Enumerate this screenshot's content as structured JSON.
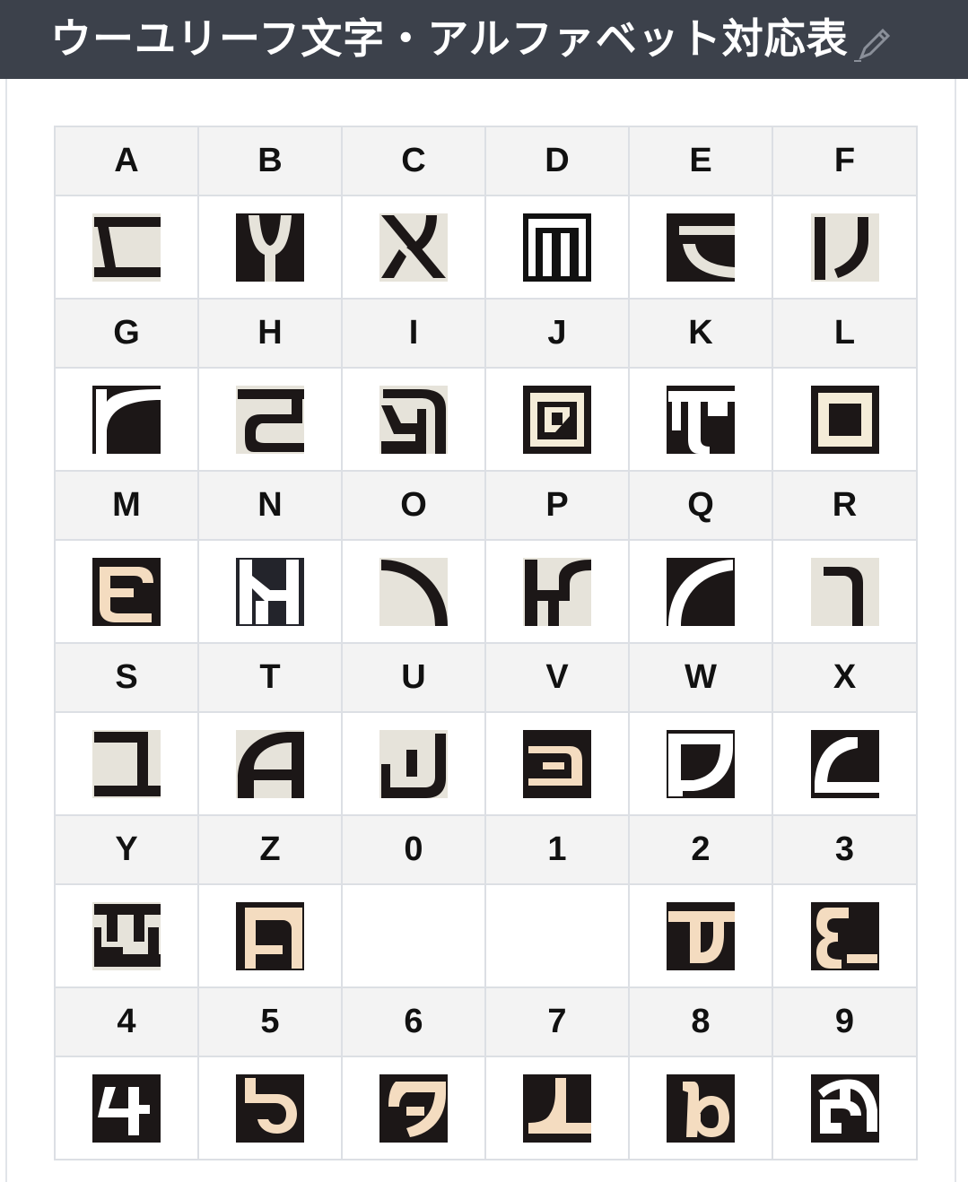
{
  "header": {
    "title": "ウーユリーフ文字・アルファベット対応表",
    "edit_icon": "pencil-icon"
  },
  "table": {
    "rows": [
      {
        "labels": [
          "A",
          "B",
          "C",
          "D",
          "E",
          "F"
        ]
      },
      {
        "labels": [
          "G",
          "H",
          "I",
          "J",
          "K",
          "L"
        ]
      },
      {
        "labels": [
          "M",
          "N",
          "O",
          "P",
          "Q",
          "R"
        ]
      },
      {
        "labels": [
          "S",
          "T",
          "U",
          "V",
          "W",
          "X"
        ]
      },
      {
        "labels": [
          "Y",
          "Z",
          "0",
          "1",
          "2",
          "3"
        ]
      },
      {
        "labels": [
          "4",
          "5",
          "6",
          "7",
          "8",
          "9"
        ]
      }
    ]
  },
  "colors": {
    "header_bg": "#3c414b",
    "light_tile": "#e6e3da",
    "dark_tile": "#1c1717",
    "label_row_bg": "#f3f3f3"
  }
}
